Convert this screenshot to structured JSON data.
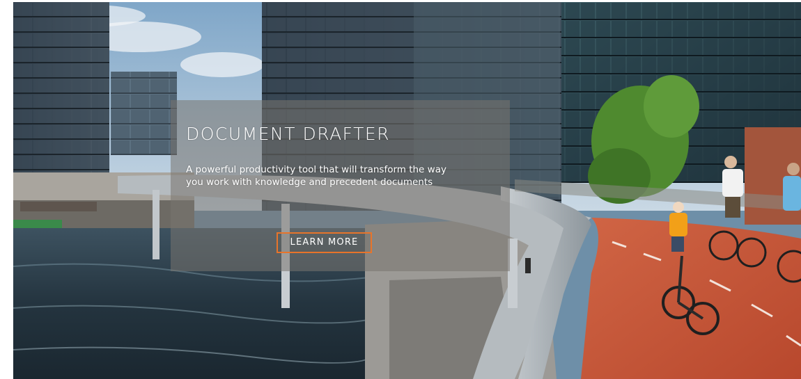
{
  "hero": {
    "title": "DOCUMENT DRAFTER",
    "subtitle": "A powerful productivity tool that will transform the way you work with knowledge and precedent documents",
    "cta_label": "LEARN MORE",
    "cta_border_color": "#e8742a"
  }
}
